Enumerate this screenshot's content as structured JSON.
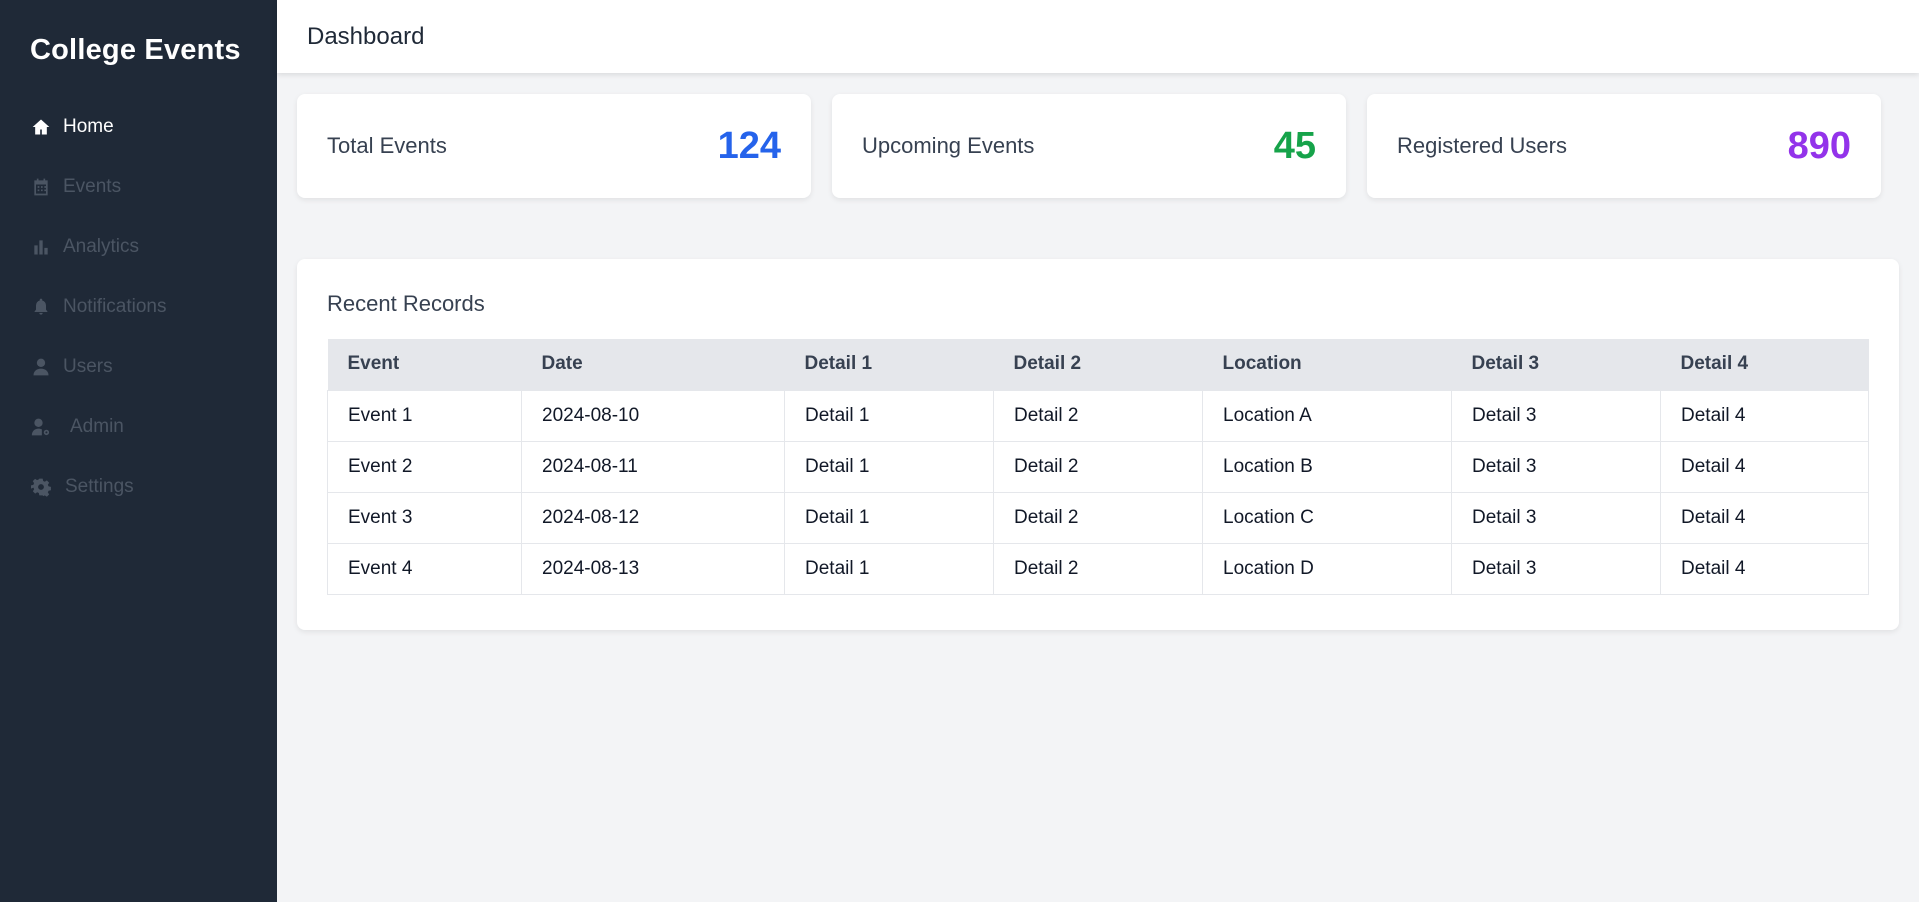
{
  "sidebar": {
    "brand": "College Events",
    "items": [
      {
        "label": "Home",
        "icon": "home-icon"
      },
      {
        "label": "Events",
        "icon": "calendar-icon"
      },
      {
        "label": "Analytics",
        "icon": "bar-chart-icon"
      },
      {
        "label": "Notifications",
        "icon": "bell-icon"
      },
      {
        "label": "Users",
        "icon": "user-icon"
      },
      {
        "label": "Admin",
        "icon": "user-cog-icon"
      },
      {
        "label": "Settings",
        "icon": "gear-icon"
      }
    ]
  },
  "header": {
    "title": "Dashboard"
  },
  "stats": [
    {
      "label": "Total Events",
      "value": "124",
      "color": "#2563eb"
    },
    {
      "label": "Upcoming Events",
      "value": "45",
      "color": "#16a34a"
    },
    {
      "label": "Registered Users",
      "value": "890",
      "color": "#9333ea"
    }
  ],
  "records": {
    "title": "Recent Records",
    "columns": [
      "Event",
      "Date",
      "Detail 1",
      "Detail 2",
      "Location",
      "Detail 3",
      "Detail 4"
    ],
    "rows": [
      [
        "Event 1",
        "2024-08-10",
        "Detail 1",
        "Detail 2",
        "Location A",
        "Detail 3",
        "Detail 4"
      ],
      [
        "Event 2",
        "2024-08-11",
        "Detail 1",
        "Detail 2",
        "Location B",
        "Detail 3",
        "Detail 4"
      ],
      [
        "Event 3",
        "2024-08-12",
        "Detail 1",
        "Detail 2",
        "Location C",
        "Detail 3",
        "Detail 4"
      ],
      [
        "Event 4",
        "2024-08-13",
        "Detail 1",
        "Detail 2",
        "Location D",
        "Detail 3",
        "Detail 4"
      ]
    ]
  },
  "colors": {
    "sidebar_bg": "#1f2937",
    "sidebar_inactive": "#4b5563",
    "page_bg": "#f3f4f6"
  }
}
